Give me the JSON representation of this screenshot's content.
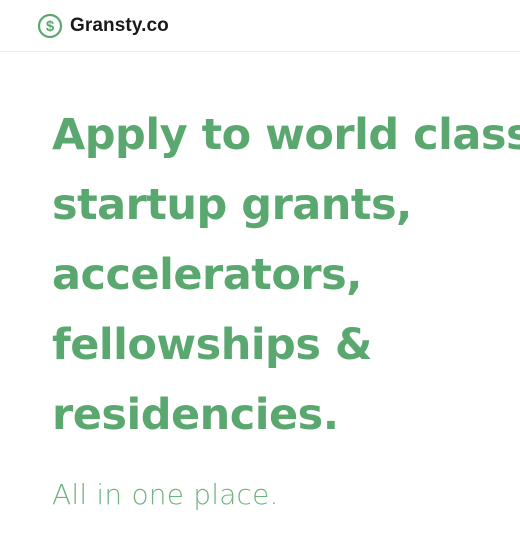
{
  "header": {
    "brand_name": "Gransty.co",
    "brand_icon": "dollar-circle-icon",
    "accent_color": "#5aa86f"
  },
  "hero": {
    "title_lines": [
      "Apply to world class",
      "startup grants,",
      "accelerators,",
      "fellowships &",
      "residencies."
    ],
    "subtitle": "All in one place."
  }
}
